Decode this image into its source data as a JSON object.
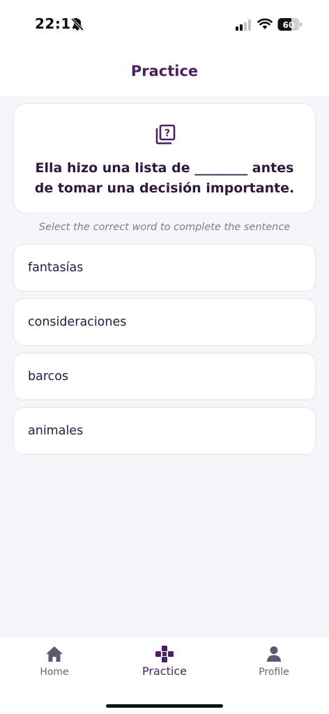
{
  "status_bar": {
    "time": "22:11",
    "battery": "60"
  },
  "header": {
    "title": "Practice"
  },
  "question": {
    "text": "Ella hizo una lista de ________ antes de tomar una decisión importante."
  },
  "instruction": "Select the correct word to complete the sentence",
  "options": [
    {
      "label": "fantasías"
    },
    {
      "label": "consideraciones"
    },
    {
      "label": "barcos"
    },
    {
      "label": "animales"
    }
  ],
  "nav": {
    "items": [
      {
        "label": "Home",
        "icon": "home-icon"
      },
      {
        "label": "Practice",
        "icon": "gamepad-icon",
        "active": true
      },
      {
        "label": "Profile",
        "icon": "person-icon"
      }
    ]
  },
  "colors": {
    "accent": "#4b2163",
    "background": "#f6f6f9",
    "card": "#ffffff",
    "border": "#e3e3ec"
  }
}
